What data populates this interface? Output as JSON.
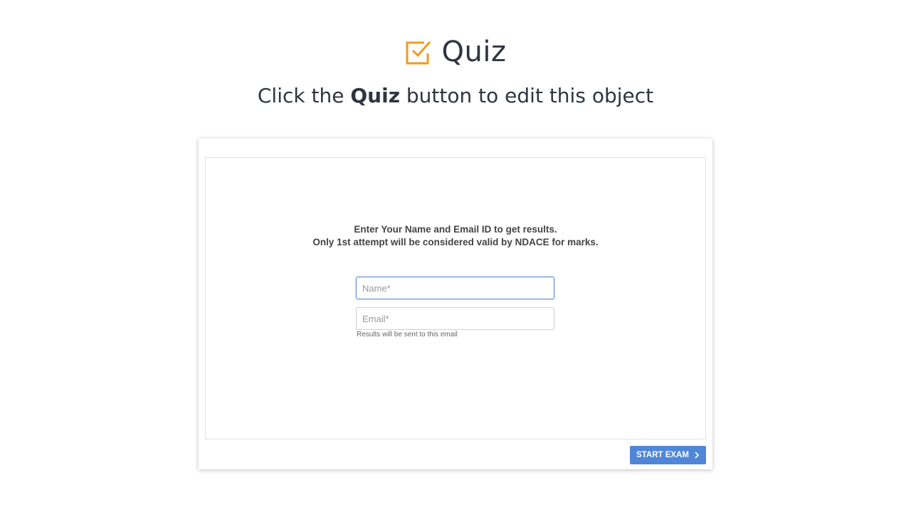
{
  "header": {
    "title": "Quiz",
    "icon": "checkbox-check-icon",
    "icon_color": "#f39a1e"
  },
  "subtitle": {
    "prefix": "Click the ",
    "bold": "Quiz",
    "suffix": " button to edit this object"
  },
  "form": {
    "instruction_line1": "Enter Your Name and Email ID to get results.",
    "instruction_line2": "Only 1st attempt will be considered valid by NDACE for marks.",
    "name_placeholder": "Name*",
    "name_value": "",
    "email_placeholder": "Email*",
    "email_value": "",
    "email_hint": "Results will be sent to this email"
  },
  "footer": {
    "start_button_label": "START EXAM",
    "start_button_icon": "chevron-right-icon",
    "accent_color": "#4f86d8"
  }
}
